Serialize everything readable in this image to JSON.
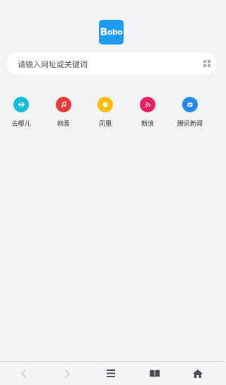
{
  "logo": {
    "text_big": "B",
    "text_rest": "obo",
    "color": "#1e9bf0"
  },
  "search": {
    "placeholder": "请输入网址或关键词",
    "value": ""
  },
  "shortcuts": [
    {
      "label": "去哪儿",
      "icon": "plane-icon",
      "color": "#13bcd6"
    },
    {
      "label": "网易",
      "icon": "music-note-icon",
      "color": "#e53935"
    },
    {
      "label": "凤凰",
      "icon": "face-icon",
      "color": "#fbbd08"
    },
    {
      "label": "新浪",
      "icon": "rss-icon",
      "color": "#e91e63"
    },
    {
      "label": "腾讯新闻",
      "icon": "news-icon",
      "color": "#2389e8"
    }
  ],
  "bottom_nav": [
    "back-icon",
    "forward-icon",
    "menu-icon",
    "bookmarks-icon",
    "home-icon"
  ]
}
